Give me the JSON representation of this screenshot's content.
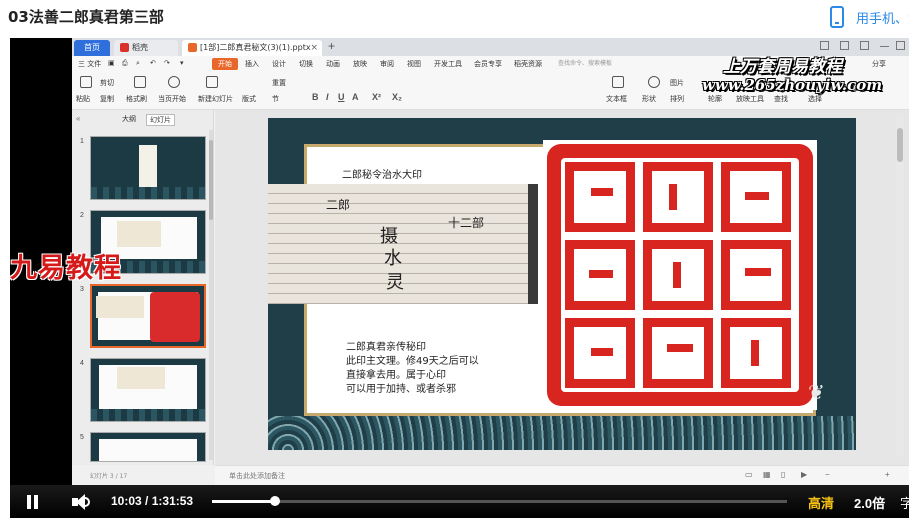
{
  "page": {
    "title": "03法善二郎真君第三部",
    "mobile_link": "用手机、免"
  },
  "app": {
    "tabs": {
      "home": "首页",
      "store": "稻壳",
      "document": "[1部]二郎真君秘文(3)(1).pptx"
    },
    "menu": {
      "file": "三 文件",
      "start": "开始",
      "insert": "插入",
      "design": "设计",
      "transition": "切换",
      "animation": "动画",
      "slideshow": "放映",
      "review": "审阅",
      "view": "视图",
      "developer": "开发工具",
      "member": "会员专享",
      "resources": "稻壳资源",
      "search": "查找命令、搜索模板",
      "share": "分享"
    },
    "toolbar": {
      "paste": "粘贴",
      "cut": "剪切",
      "copy": "复制",
      "format_painter": "格式刷",
      "from_start": "当页开始",
      "new_slide": "新建幻灯片",
      "layout": "版式",
      "section": "节",
      "reset": "重置",
      "textbox": "文本框",
      "shape": "形状",
      "arrange": "排列",
      "outline": "轮廓",
      "picture": "图片",
      "play_tools": "放映工具",
      "find": "查找",
      "select": "选择"
    },
    "watermark": {
      "title": "上万套周易教程",
      "url": "www.265zhouyiw.com"
    },
    "left_panel": {
      "tab_outline": "大纲",
      "tab_slides": "幻灯片",
      "numbers": [
        "1",
        "2",
        "3",
        "4",
        "5"
      ],
      "add": "+"
    },
    "slide": {
      "heading": "二郎秘令治水大印",
      "photo_text": [
        "二郎",
        "十二部",
        "摄",
        "水",
        "灵"
      ],
      "body_lines": [
        "二郎真君亲传秘印",
        "此印主文理。修49天之后可以",
        "直接拿去用。属于心印",
        "可以用于加持、或者杀邪"
      ]
    },
    "notes_placeholder": "单击此处添加备注",
    "status": "幻灯片 3 / 17"
  },
  "overlay_logo": "九易教程",
  "player": {
    "current_time": "10:03",
    "separator": "/",
    "total_time": "1:31:53",
    "progress": 0.1094,
    "quality": "高清",
    "speed": "2.0倍",
    "extra": "字"
  }
}
